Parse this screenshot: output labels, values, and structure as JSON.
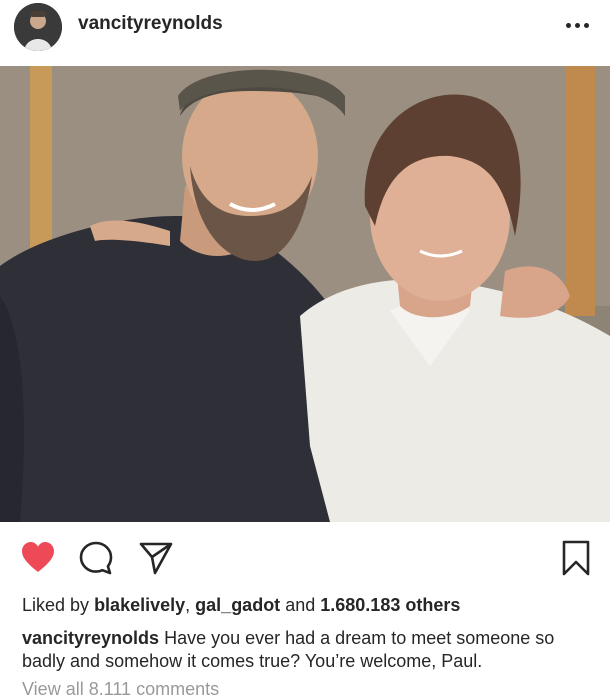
{
  "post": {
    "username": "vancityreynolds",
    "more_icon": "more-horizontal-icon",
    "photo_alt": "photo-content"
  },
  "actions": {
    "like_icon": "heart-filled-icon",
    "comment_icon": "comment-icon",
    "share_icon": "paper-plane-icon",
    "save_icon": "bookmark-icon",
    "like_color": "#ed4956"
  },
  "likes": {
    "prefix": "Liked by",
    "user1": "blakelively",
    "separator": ",",
    "user2": "gal_gadot",
    "and": "and",
    "count": "1.680.183 others"
  },
  "caption": {
    "username": "vancityreynolds",
    "text": "Have you ever had a dream to meet someone so badly and somehow it comes true? You’re welcome, Paul."
  },
  "comments": {
    "view_all": "View all 8.111 comments"
  }
}
